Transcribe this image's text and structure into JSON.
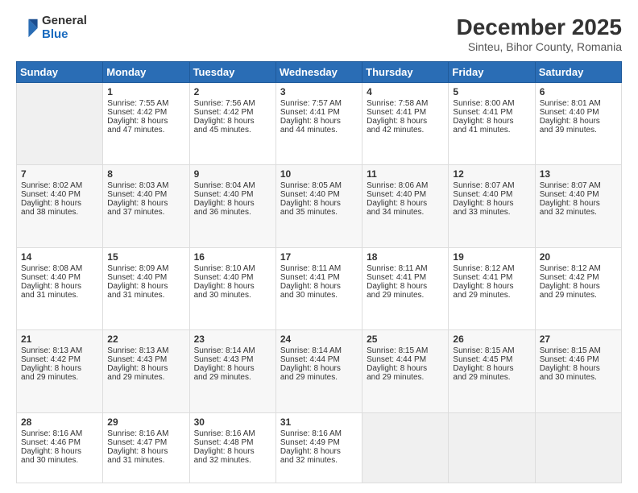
{
  "logo": {
    "general": "General",
    "blue": "Blue"
  },
  "header": {
    "title": "December 2025",
    "subtitle": "Sinteu, Bihor County, Romania"
  },
  "days_of_week": [
    "Sunday",
    "Monday",
    "Tuesday",
    "Wednesday",
    "Thursday",
    "Friday",
    "Saturday"
  ],
  "weeks": [
    [
      {
        "day": "",
        "content": ""
      },
      {
        "day": "1",
        "content": "Sunrise: 7:55 AM\nSunset: 4:42 PM\nDaylight: 8 hours\nand 47 minutes."
      },
      {
        "day": "2",
        "content": "Sunrise: 7:56 AM\nSunset: 4:42 PM\nDaylight: 8 hours\nand 45 minutes."
      },
      {
        "day": "3",
        "content": "Sunrise: 7:57 AM\nSunset: 4:41 PM\nDaylight: 8 hours\nand 44 minutes."
      },
      {
        "day": "4",
        "content": "Sunrise: 7:58 AM\nSunset: 4:41 PM\nDaylight: 8 hours\nand 42 minutes."
      },
      {
        "day": "5",
        "content": "Sunrise: 8:00 AM\nSunset: 4:41 PM\nDaylight: 8 hours\nand 41 minutes."
      },
      {
        "day": "6",
        "content": "Sunrise: 8:01 AM\nSunset: 4:40 PM\nDaylight: 8 hours\nand 39 minutes."
      }
    ],
    [
      {
        "day": "7",
        "content": "Sunrise: 8:02 AM\nSunset: 4:40 PM\nDaylight: 8 hours\nand 38 minutes."
      },
      {
        "day": "8",
        "content": "Sunrise: 8:03 AM\nSunset: 4:40 PM\nDaylight: 8 hours\nand 37 minutes."
      },
      {
        "day": "9",
        "content": "Sunrise: 8:04 AM\nSunset: 4:40 PM\nDaylight: 8 hours\nand 36 minutes."
      },
      {
        "day": "10",
        "content": "Sunrise: 8:05 AM\nSunset: 4:40 PM\nDaylight: 8 hours\nand 35 minutes."
      },
      {
        "day": "11",
        "content": "Sunrise: 8:06 AM\nSunset: 4:40 PM\nDaylight: 8 hours\nand 34 minutes."
      },
      {
        "day": "12",
        "content": "Sunrise: 8:07 AM\nSunset: 4:40 PM\nDaylight: 8 hours\nand 33 minutes."
      },
      {
        "day": "13",
        "content": "Sunrise: 8:07 AM\nSunset: 4:40 PM\nDaylight: 8 hours\nand 32 minutes."
      }
    ],
    [
      {
        "day": "14",
        "content": "Sunrise: 8:08 AM\nSunset: 4:40 PM\nDaylight: 8 hours\nand 31 minutes."
      },
      {
        "day": "15",
        "content": "Sunrise: 8:09 AM\nSunset: 4:40 PM\nDaylight: 8 hours\nand 31 minutes."
      },
      {
        "day": "16",
        "content": "Sunrise: 8:10 AM\nSunset: 4:40 PM\nDaylight: 8 hours\nand 30 minutes."
      },
      {
        "day": "17",
        "content": "Sunrise: 8:11 AM\nSunset: 4:41 PM\nDaylight: 8 hours\nand 30 minutes."
      },
      {
        "day": "18",
        "content": "Sunrise: 8:11 AM\nSunset: 4:41 PM\nDaylight: 8 hours\nand 29 minutes."
      },
      {
        "day": "19",
        "content": "Sunrise: 8:12 AM\nSunset: 4:41 PM\nDaylight: 8 hours\nand 29 minutes."
      },
      {
        "day": "20",
        "content": "Sunrise: 8:12 AM\nSunset: 4:42 PM\nDaylight: 8 hours\nand 29 minutes."
      }
    ],
    [
      {
        "day": "21",
        "content": "Sunrise: 8:13 AM\nSunset: 4:42 PM\nDaylight: 8 hours\nand 29 minutes."
      },
      {
        "day": "22",
        "content": "Sunrise: 8:13 AM\nSunset: 4:43 PM\nDaylight: 8 hours\nand 29 minutes."
      },
      {
        "day": "23",
        "content": "Sunrise: 8:14 AM\nSunset: 4:43 PM\nDaylight: 8 hours\nand 29 minutes."
      },
      {
        "day": "24",
        "content": "Sunrise: 8:14 AM\nSunset: 4:44 PM\nDaylight: 8 hours\nand 29 minutes."
      },
      {
        "day": "25",
        "content": "Sunrise: 8:15 AM\nSunset: 4:44 PM\nDaylight: 8 hours\nand 29 minutes."
      },
      {
        "day": "26",
        "content": "Sunrise: 8:15 AM\nSunset: 4:45 PM\nDaylight: 8 hours\nand 29 minutes."
      },
      {
        "day": "27",
        "content": "Sunrise: 8:15 AM\nSunset: 4:46 PM\nDaylight: 8 hours\nand 30 minutes."
      }
    ],
    [
      {
        "day": "28",
        "content": "Sunrise: 8:16 AM\nSunset: 4:46 PM\nDaylight: 8 hours\nand 30 minutes."
      },
      {
        "day": "29",
        "content": "Sunrise: 8:16 AM\nSunset: 4:47 PM\nDaylight: 8 hours\nand 31 minutes."
      },
      {
        "day": "30",
        "content": "Sunrise: 8:16 AM\nSunset: 4:48 PM\nDaylight: 8 hours\nand 32 minutes."
      },
      {
        "day": "31",
        "content": "Sunrise: 8:16 AM\nSunset: 4:49 PM\nDaylight: 8 hours\nand 32 minutes."
      },
      {
        "day": "",
        "content": ""
      },
      {
        "day": "",
        "content": ""
      },
      {
        "day": "",
        "content": ""
      }
    ]
  ]
}
